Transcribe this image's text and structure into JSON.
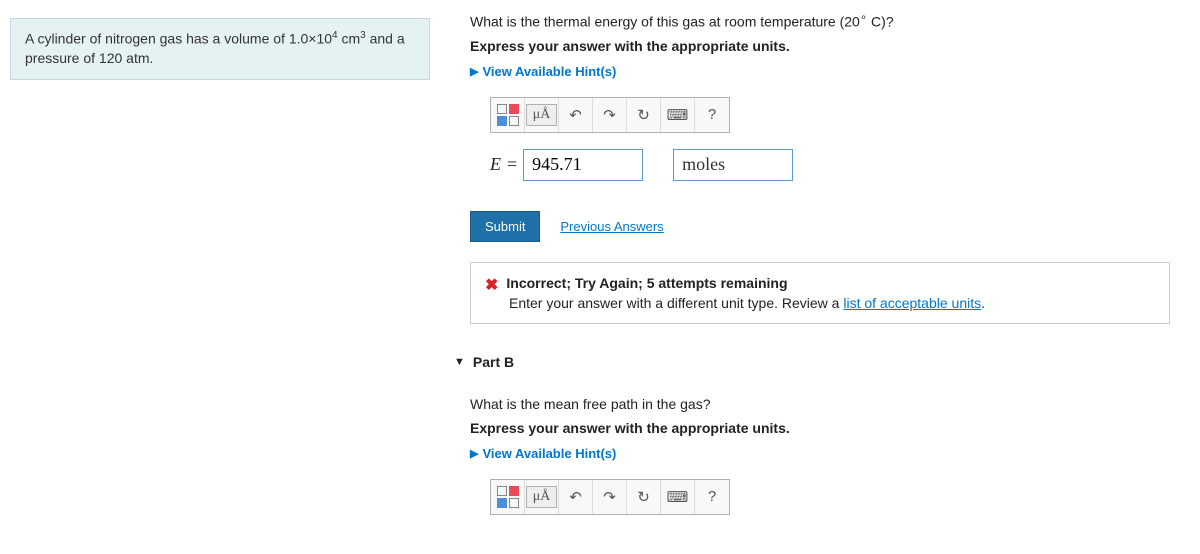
{
  "problem": {
    "text_prefix": "A cylinder of nitrogen gas has a volume of 1.0×10",
    "vol_exp": "4",
    "unit_cm": " cm",
    "cm_exp": "3",
    "text_suffix": " and a pressure of 120 atm."
  },
  "partA": {
    "question_prefix": "What is the thermal energy of this gas at room temperature (20",
    "deg": "∘",
    "question_suffix": " C)?",
    "instruction": "Express your answer with the appropriate units.",
    "hint_label": "View Available Hint(s)",
    "toolbar": {
      "units": "μÅ",
      "undo": "↶",
      "redo": "↷",
      "reset": "↻",
      "keyboard": "⌨",
      "help": "?"
    },
    "eq_var": "E",
    "eq_sign": " = ",
    "value": "945.71",
    "unit_value": "moles",
    "submit_label": "Submit",
    "prev_label": "Previous Answers",
    "feedback": {
      "icon": "✖",
      "title": "Incorrect; Try Again; 5 attempts remaining",
      "body_pre": "Enter your answer with a different unit type. Review a ",
      "link": "list of acceptable units",
      "body_post": "."
    }
  },
  "partB": {
    "header": "Part B",
    "question": "What is the mean free path in the gas?",
    "instruction": "Express your answer with the appropriate units.",
    "hint_label": "View Available Hint(s)",
    "toolbar": {
      "units": "μÅ",
      "undo": "↶",
      "redo": "↷",
      "reset": "↻",
      "keyboard": "⌨",
      "help": "?"
    }
  }
}
